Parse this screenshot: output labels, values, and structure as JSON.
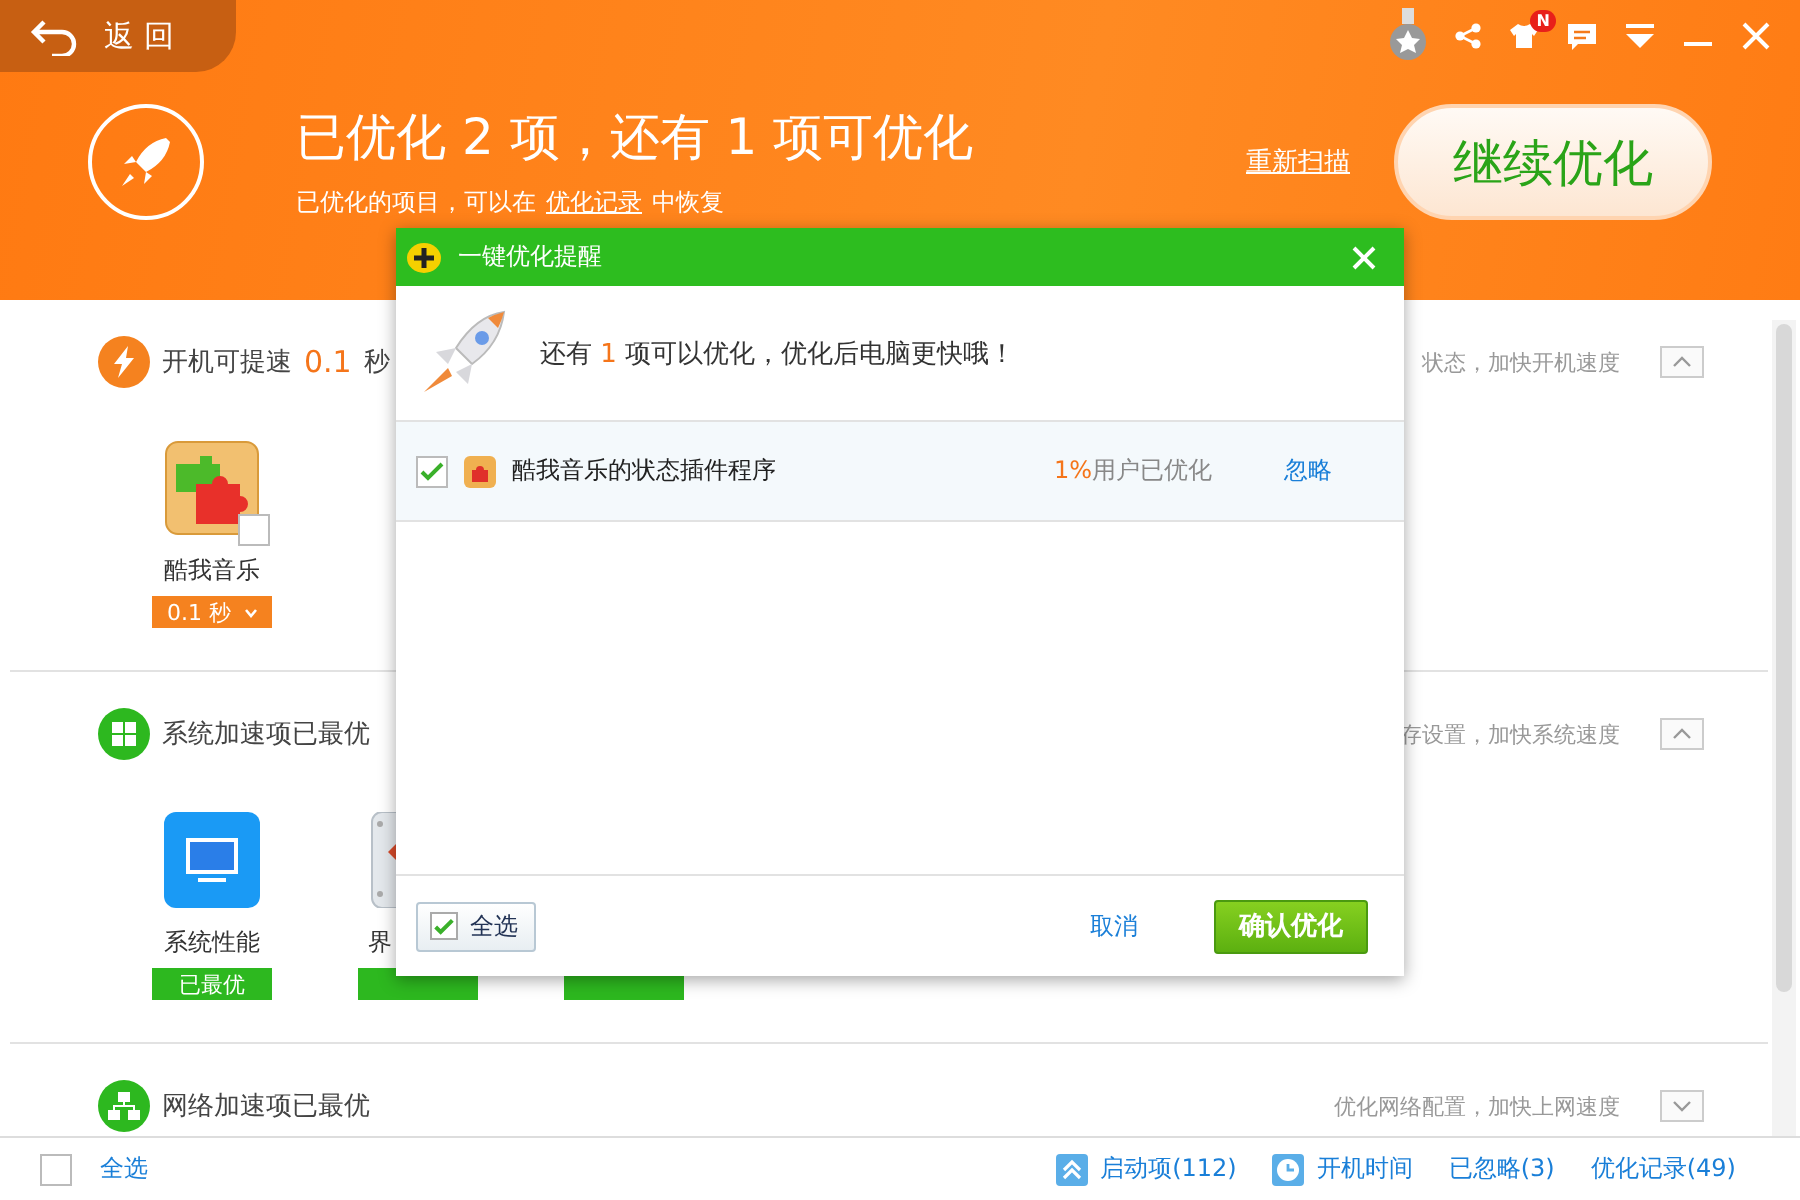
{
  "back_button": {
    "label": "返 回"
  },
  "notification_badge": "N",
  "header": {
    "title": "已优化 2 项，还有 1 项可优化",
    "subtitle_before": "已优化的项目，可以在",
    "subtitle_link": "优化记录",
    "subtitle_after": "中恢复",
    "rescan": "重新扫描",
    "continue": "继续优化"
  },
  "sections": [
    {
      "color": "#f5821f",
      "title": "开机可提速",
      "value": "0.1",
      "unit": "秒",
      "hint": "状态，加快开机速度",
      "expanded": true,
      "items": [
        {
          "kind": "full",
          "label": "酷我音乐",
          "checked": false,
          "badge": {
            "kind": "time",
            "text": "0.1 秒"
          }
        }
      ]
    },
    {
      "color": "#2db81f",
      "title": "系统加速项已最优",
      "hint": "存设置，加快系统速度",
      "expanded": true,
      "items": [
        {
          "kind": "full",
          "label": "系统性能",
          "badge": {
            "kind": "optimal",
            "text": "已最优"
          }
        },
        {
          "kind": "partial",
          "label": "界",
          "badge": {
            "kind": "optimal"
          }
        },
        {
          "kind": "hidden",
          "badge": {
            "kind": "optimal"
          }
        }
      ]
    },
    {
      "color": "#2db81f",
      "title": "网络加速项已最优",
      "hint": "优化网络配置，加快上网速度",
      "expanded": false
    }
  ],
  "status_bar": {
    "select_all": {
      "label": "全选",
      "checked": false
    },
    "links": [
      {
        "label": "启动项(112)"
      },
      {
        "label": "开机时间"
      },
      {
        "label": "已忽略(3)"
      },
      {
        "label": "优化记录(49)"
      }
    ]
  },
  "dialog": {
    "title": "一键优化提醒",
    "message_before": "还有",
    "count": "1",
    "message_after": "项可以优化，优化后电脑更快哦！",
    "rows": [
      {
        "checked": true,
        "name": "酷我音乐的状态插件程序",
        "percent": "1%",
        "percent_suffix": "用户已优化",
        "action": "忽略"
      }
    ],
    "select_all": {
      "label": "全选",
      "checked": true
    },
    "cancel": "取消",
    "confirm": "确认优化"
  }
}
